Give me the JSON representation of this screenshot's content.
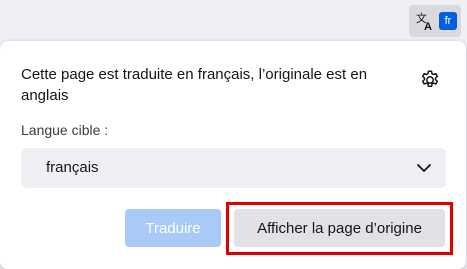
{
  "toolbar": {
    "translate_icon": "translate-icon",
    "lang_badge": "fr"
  },
  "panel": {
    "message": "Cette page est traduite en français, l’originale est en anglais",
    "settings_icon": "gear-icon",
    "target_label": "Langue cible :",
    "target_language": "français",
    "translate_label": "Traduire",
    "show_original_label": "Afficher la page d’origine"
  },
  "colors": {
    "accent": "#0060df",
    "disabled_primary": "#a9c9f7",
    "secondary_button": "#e1e1e6",
    "highlight": "#e00000"
  }
}
